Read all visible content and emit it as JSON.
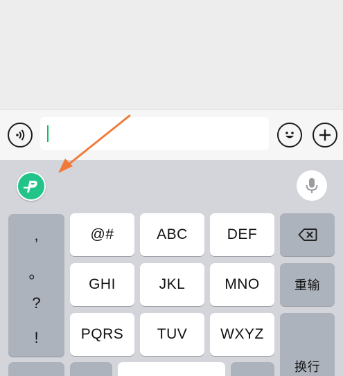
{
  "chat": {},
  "input_bar": {
    "voice_icon": "voice-wave-icon",
    "text_value": "",
    "emoji_icon": "smiley-icon",
    "plus_icon": "plus-icon"
  },
  "keyboard": {
    "toolbar": {
      "logo_icon": "p-logo-icon",
      "mic_icon": "microphone-icon"
    },
    "punctuation": [
      ",",
      "。",
      "?",
      "!"
    ],
    "keys": {
      "r1c1": "@#",
      "r1c2": "ABC",
      "r1c3": "DEF",
      "r2c1": "GHI",
      "r2c2": "JKL",
      "r2c3": "MNO",
      "r3c1": "PQRS",
      "r3c2": "TUV",
      "r3c3": "WXYZ"
    },
    "backspace_icon": "backspace-icon",
    "reenter_label": "重输",
    "newline_label": "换行"
  },
  "annotation": {
    "arrow_color": "#f07a3a",
    "pointing_at": "p-logo-icon"
  }
}
